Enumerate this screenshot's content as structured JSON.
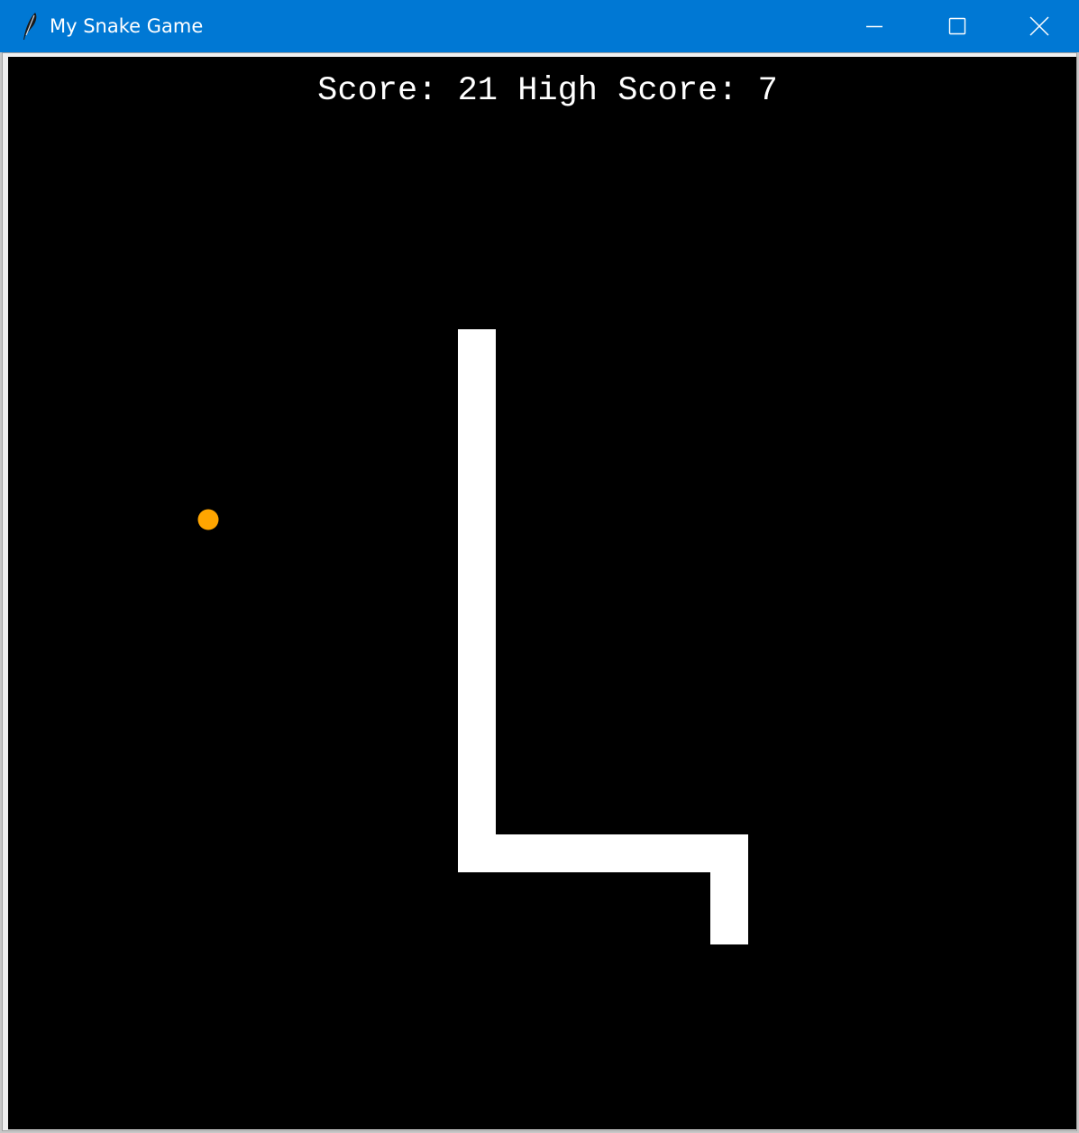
{
  "window": {
    "title": "My Snake Game",
    "icon": "feather-icon",
    "controls": [
      "minimize-icon",
      "maximize-icon",
      "close-icon"
    ],
    "titlebar_color": "#0078d4"
  },
  "game": {
    "score_label": "Score:",
    "score": 21,
    "high_score_label": "High Score:",
    "high_score": 7,
    "score_text": "Score: 21 High Score: 7",
    "background_color": "#000000",
    "snake_color": "#ffffff",
    "food_color": "#ffa500"
  }
}
